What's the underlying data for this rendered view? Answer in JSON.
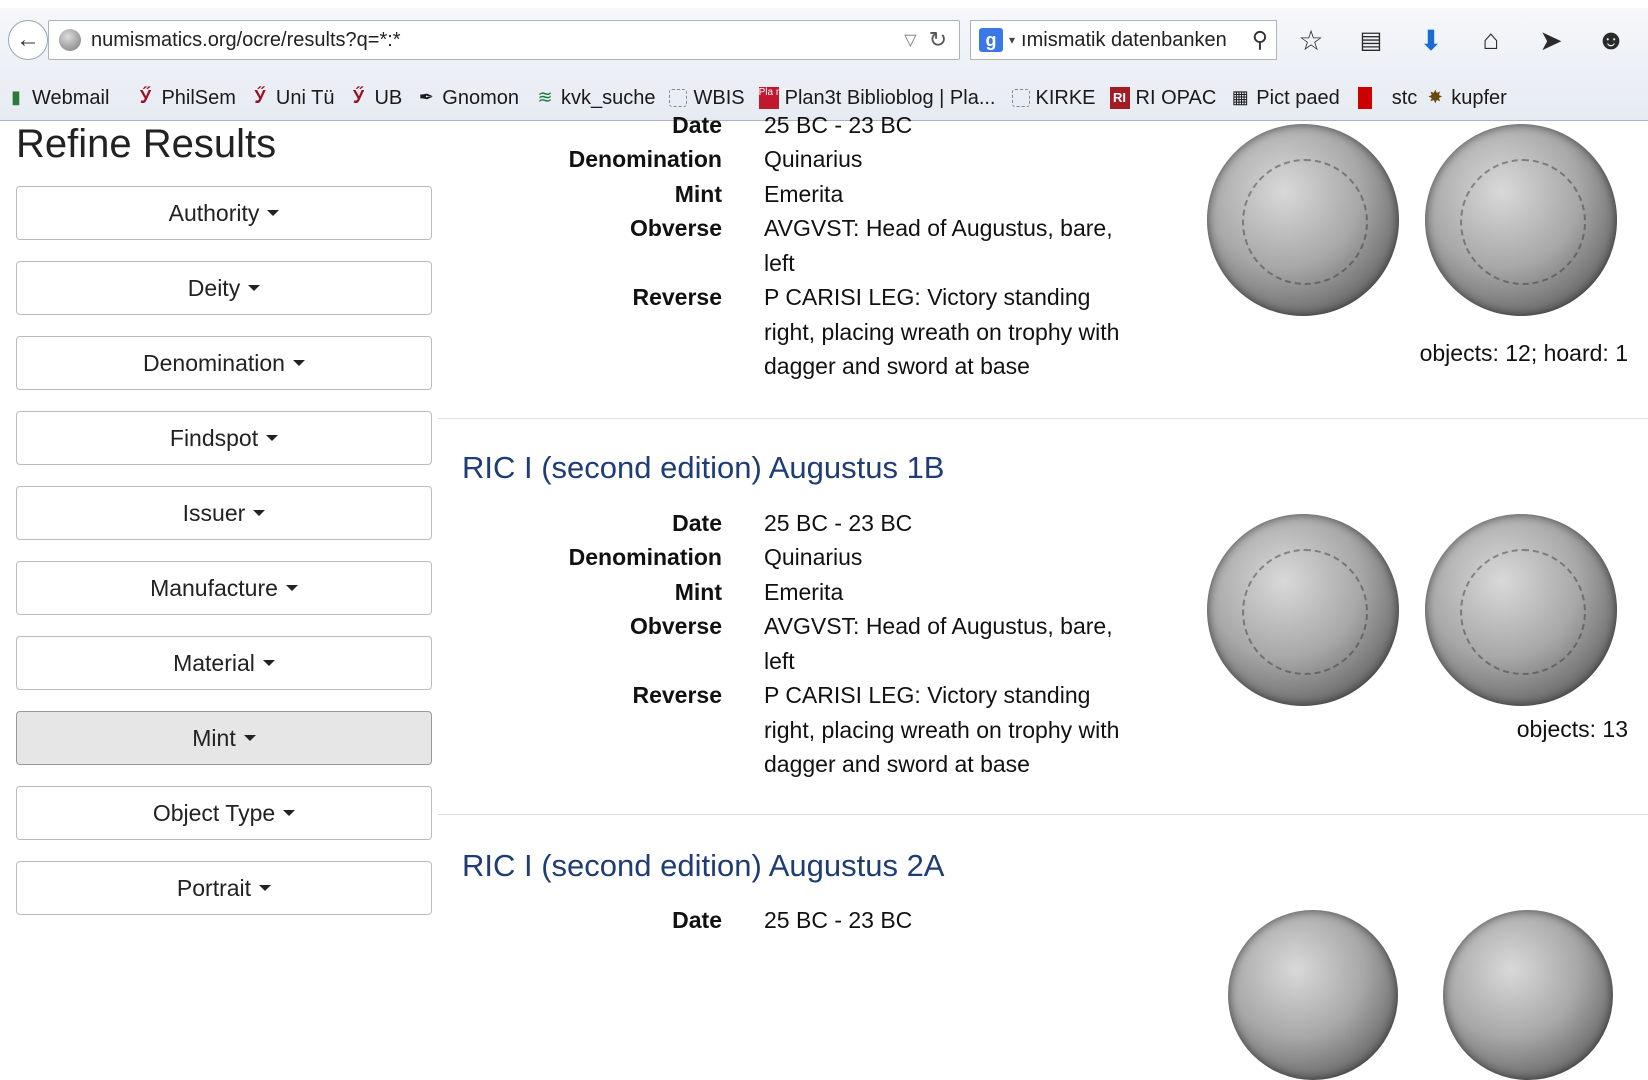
{
  "browser": {
    "url": "numismatics.org/ocre/results?q=*:*",
    "search_text": "ımismatik datenbanken",
    "icons": [
      "back-icon",
      "star-icon",
      "reading-list-icon",
      "download-icon",
      "home-icon",
      "send-icon",
      "chat-icon"
    ]
  },
  "bookmarks": [
    {
      "label": "Webmail",
      "icon": "bookmark-icon"
    },
    {
      "label": "PhilSem",
      "icon": "wine-glass-icon"
    },
    {
      "label": "Uni Tü",
      "icon": "wine-glass-icon"
    },
    {
      "label": "UB",
      "icon": "wine-glass-icon"
    },
    {
      "label": "Gnomon",
      "icon": "quill-icon"
    },
    {
      "label": "kvk_suche",
      "icon": "wave-icon"
    },
    {
      "label": "WBIS",
      "icon": "dotted-box-icon"
    },
    {
      "label": "Plan3t Biblioblog | Pla...",
      "icon": "plan3t-icon"
    },
    {
      "label": "KIRKE",
      "icon": "dotted-box-icon"
    },
    {
      "label": "RI OPAC",
      "icon": "ri-icon"
    },
    {
      "label": "Pict paed",
      "icon": "building-icon"
    },
    {
      "label": "stc",
      "icon": "red-bar-icon"
    },
    {
      "label": "kupfer",
      "icon": "coin-icon"
    }
  ],
  "sidebar": {
    "title": "Refine Results",
    "facets": [
      "Authority",
      "Deity",
      "Denomination",
      "Findspot",
      "Issuer",
      "Manufacture",
      "Material",
      "Mint",
      "Object Type",
      "Portrait"
    ]
  },
  "labels": {
    "date": "Date",
    "denomination": "Denomination",
    "mint": "Mint",
    "obverse": "Obverse",
    "reverse": "Reverse"
  },
  "results": [
    {
      "title": "",
      "date": "25 BC - 23 BC",
      "denomination": "Quinarius",
      "mint": "Emerita",
      "obverse": "AVGVST: Head of Augustus, bare, left",
      "reverse": "P CARISI LEG: Victory standing right, placing wreath on trophy with dagger and sword at base",
      "objects": "objects: 12; hoard: 1"
    },
    {
      "title": "RIC I (second edition) Augustus 1B",
      "date": "25 BC - 23 BC",
      "denomination": "Quinarius",
      "mint": "Emerita",
      "obverse": "AVGVST: Head of Augustus, bare, left",
      "reverse": "P CARISI LEG: Victory standing right, placing wreath on trophy with dagger and sword at base",
      "objects": "objects: 13"
    },
    {
      "title": "RIC I (second edition) Augustus 2A",
      "date": "25 BC - 23 BC"
    }
  ]
}
